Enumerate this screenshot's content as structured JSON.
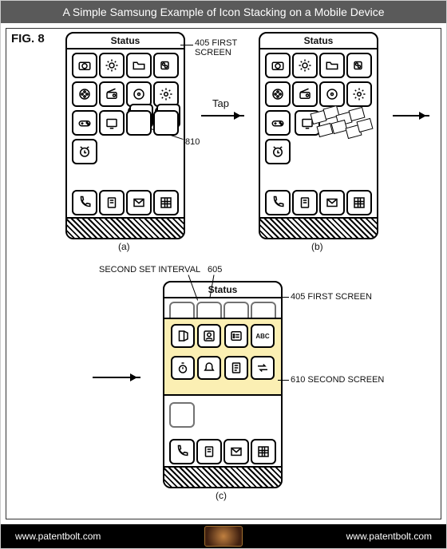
{
  "title": "A Simple Samsung Example of Icon Stacking on a Mobile Device",
  "figure_label": "FIG. 8",
  "status_text": "Status",
  "tap_label": "Tap",
  "callouts": {
    "first_screen": "405 FIRST\nSCREEN",
    "first_screen_inline": "405 FIRST SCREEN",
    "stack_ref": "810",
    "second_set_interval": "SECOND SET INTERVAL",
    "second_set_interval_ref": "605",
    "second_screen": "610 SECOND SCREEN"
  },
  "sub_labels": {
    "a": "(a)",
    "b": "(b)",
    "c": "(c)"
  },
  "icons": {
    "row1": [
      "camera",
      "sun",
      "folder",
      "video"
    ],
    "row2": [
      "film",
      "radio",
      "disc",
      "gear"
    ],
    "row3_a": [
      "gamepad",
      "tv",
      "stack",
      "stack"
    ],
    "row3_b": [
      "gamepad",
      "tv",
      "",
      ""
    ],
    "row4": [
      "alarm",
      "",
      "",
      ""
    ],
    "dock": [
      "phone",
      "book",
      "mail",
      "grid"
    ],
    "panel1": [
      "door",
      "contact",
      "list",
      "abc"
    ],
    "panel2": [
      "stopwatch",
      "bell",
      "note",
      "swap"
    ]
  },
  "footer": {
    "left": "www.patentbolt.com",
    "right": "www.patentbolt.com"
  }
}
